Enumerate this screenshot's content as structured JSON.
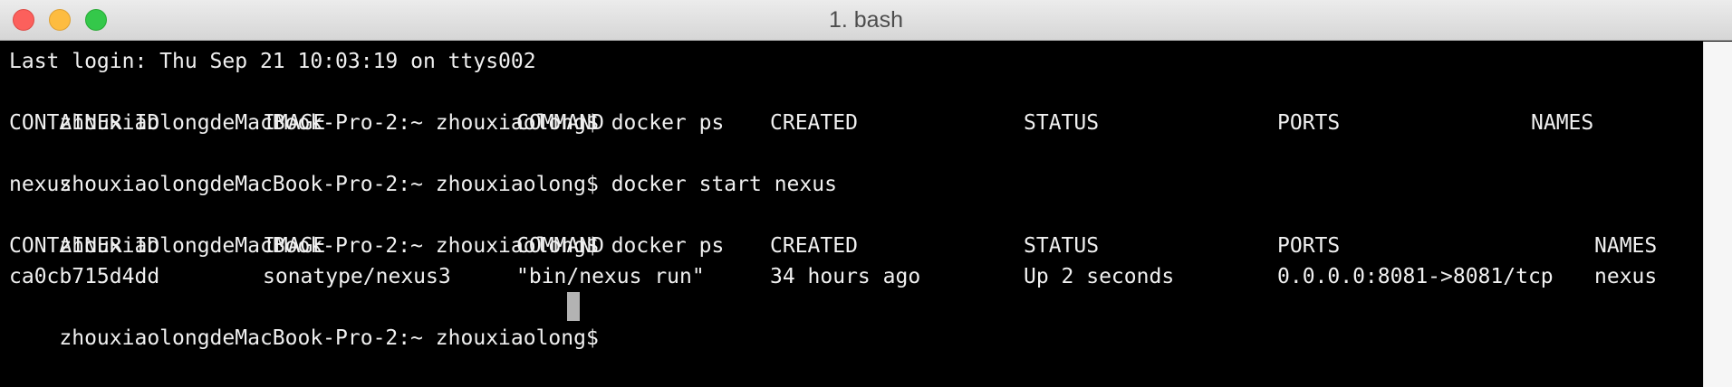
{
  "window": {
    "title": "1. bash"
  },
  "terminal": {
    "last_login": "Last login: Thu Sep 21 10:03:19 on ttys002",
    "prompt": "zhouxiaolongdeMacBook-Pro-2:~ zhouxiaolong$",
    "cmd1": "docker ps",
    "table1_header": [
      "CONTAINER ID",
      "IMAGE",
      "COMMAND",
      "CREATED",
      "STATUS",
      "PORTS",
      "NAMES"
    ],
    "cmd2": "docker start nexus",
    "output2": "nexus",
    "cmd3": "docker ps",
    "table2_header": [
      "CONTAINER ID",
      "IMAGE",
      "COMMAND",
      "CREATED",
      "STATUS",
      "PORTS",
      "NAMES"
    ],
    "table2_row": [
      "ca0cb715d4dd",
      "sonatype/nexus3",
      "\"bin/nexus run\"",
      "34 hours ago",
      "Up 2 seconds",
      "0.0.0.0:8081->8081/tcp",
      "nexus"
    ]
  },
  "colors": {
    "background": "#000000",
    "foreground": "#f0f0f0",
    "cursor": "#b3b3b3",
    "close_button": "#fc605c",
    "minimize_button": "#fdbc40",
    "maximize_button": "#34c84a"
  }
}
